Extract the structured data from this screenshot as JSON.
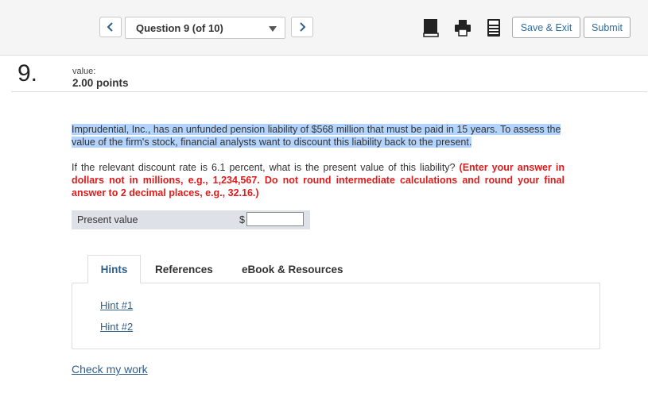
{
  "header": {
    "question_select": "Question 9 (of 10)",
    "save_exit": "Save & Exit",
    "submit": "Submit"
  },
  "question": {
    "number": "9.",
    "value_label": "value:",
    "points": "2.00 points",
    "para1": "Imprudential, Inc., has an unfunded pension liability of $568 million that must be paid in 15 years. To assess the value of the firm's stock, financial analysts want to discount this liability back to the present.",
    "para2_plain": "If the relevant discount rate is 6.1 percent, what is the present value of this liability? ",
    "para2_red": "(Enter your answer in dollars not in millions, e.g., 1,234,567. Do not round intermediate calculations and round your final answer to 2 decimal places, e.g., 32.16.)",
    "answer_label": "Present value",
    "currency": "$",
    "answer_value": ""
  },
  "tabs": [
    {
      "label": "Hints"
    },
    {
      "label": "References"
    },
    {
      "label": "eBook & Resources"
    }
  ],
  "hints": [
    "Hint #1",
    "Hint #2"
  ],
  "check_my_work": "Check my work",
  "icons": [
    "chevron-left-icon",
    "chevron-right-icon",
    "dropdown-caret-icon",
    "book-icon",
    "print-icon",
    "calculator-icon"
  ],
  "colors": {
    "link": "#2e5e8a",
    "instruction_red": "#e01b1b",
    "highlight": "#b3d4fc"
  }
}
